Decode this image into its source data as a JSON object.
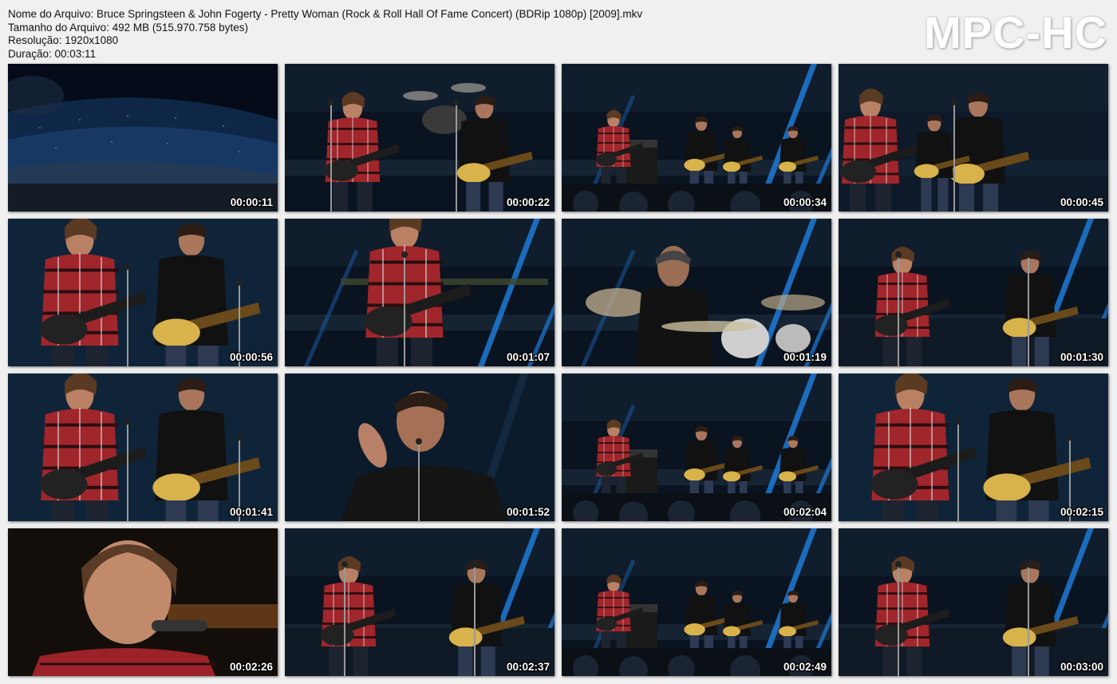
{
  "file_info": {
    "name_line": "Nome do Arquivo: Bruce Springsteen & John Fogerty - Pretty Woman (Rock & Roll Hall Of Fame Concert) (BDRip 1080p) [2009].mkv",
    "size_line": "Tamanho do Arquivo: 492 MB (515.970.758 bytes)",
    "resolution_line": "Resolução: 1920x1080",
    "duration_line": "Duração: 00:03:11"
  },
  "logo": "MPC-HC",
  "thumbnails": [
    {
      "time": "00:00:11",
      "scene": "arena-crowd"
    },
    {
      "time": "00:00:22",
      "scene": "two-guitarists"
    },
    {
      "time": "00:00:34",
      "scene": "wide-stage-band"
    },
    {
      "time": "00:00:45",
      "scene": "two-guitarists-side"
    },
    {
      "time": "00:00:56",
      "scene": "closeup-pair"
    },
    {
      "time": "00:01:07",
      "scene": "singer-plaid"
    },
    {
      "time": "00:01:19",
      "scene": "drummer"
    },
    {
      "time": "00:01:30",
      "scene": "two-guitarists-blue"
    },
    {
      "time": "00:01:41",
      "scene": "closeup-pair"
    },
    {
      "time": "00:01:52",
      "scene": "singer-closeup-hand"
    },
    {
      "time": "00:02:04",
      "scene": "wide-stage-band"
    },
    {
      "time": "00:02:15",
      "scene": "closeup-pair"
    },
    {
      "time": "00:02:26",
      "scene": "singer-face-closeup"
    },
    {
      "time": "00:02:37",
      "scene": "two-guitarists-blue"
    },
    {
      "time": "00:02:49",
      "scene": "wide-stage-band"
    },
    {
      "time": "00:03:00",
      "scene": "two-guitarists-blue"
    }
  ]
}
